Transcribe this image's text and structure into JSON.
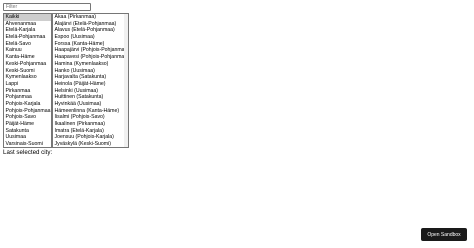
{
  "filter": {
    "placeholder": "Filter",
    "value": ""
  },
  "regions": {
    "selected_index": 0,
    "items": [
      "Kaikki",
      "Ahvenanmaa",
      "Etelä-Karjala",
      "Etelä-Pohjanmaa",
      "Etelä-Savo",
      "Kainuu",
      "Kanta-Häme",
      "Keski-Pohjanmaa",
      "Keski-Suomi",
      "Kymenlaakso",
      "Lappi",
      "Pirkanmaa",
      "Pohjanmaa",
      "Pohjois-Karjala",
      "Pohjois-Pohjanmaa",
      "Pohjois-Savo",
      "Päijät-Häme",
      "Satakunta",
      "Uusimaa",
      "Varsinais-Suomi"
    ]
  },
  "cities": {
    "items": [
      "Akaa (Pirkanmaa)",
      "Alajärvi (Etelä-Pohjanmaa)",
      "Alavus (Etelä-Pohjanmaa)",
      "Espoo (Uusimaa)",
      "Forssa (Kanta-Häme)",
      "Haapajärvi (Pohjois-Pohjanmaa)",
      "Haapavesi (Pohjois-Pohjanmaa)",
      "Hamina (Kymenlaakso)",
      "Hanko (Uusimaa)",
      "Harjavalta (Satakunta)",
      "Heinola (Päijät-Häme)",
      "Helsinki (Uusimaa)",
      "Huittinen (Satakunta)",
      "Hyvinkää (Uusimaa)",
      "Hämeenlinna (Kanta-Häme)",
      "Iisalmi (Pohjois-Savo)",
      "Ikaalinen (Pirkanmaa)",
      "Imatra (Etelä-Karjala)",
      "Joensuu (Pohjois-Karjala)",
      "Jyväskylä (Keski-Suomi)"
    ]
  },
  "last_selected": {
    "label": "Last selected city:",
    "value": ""
  },
  "sandbox_button": {
    "label": "Open Sandbox"
  }
}
